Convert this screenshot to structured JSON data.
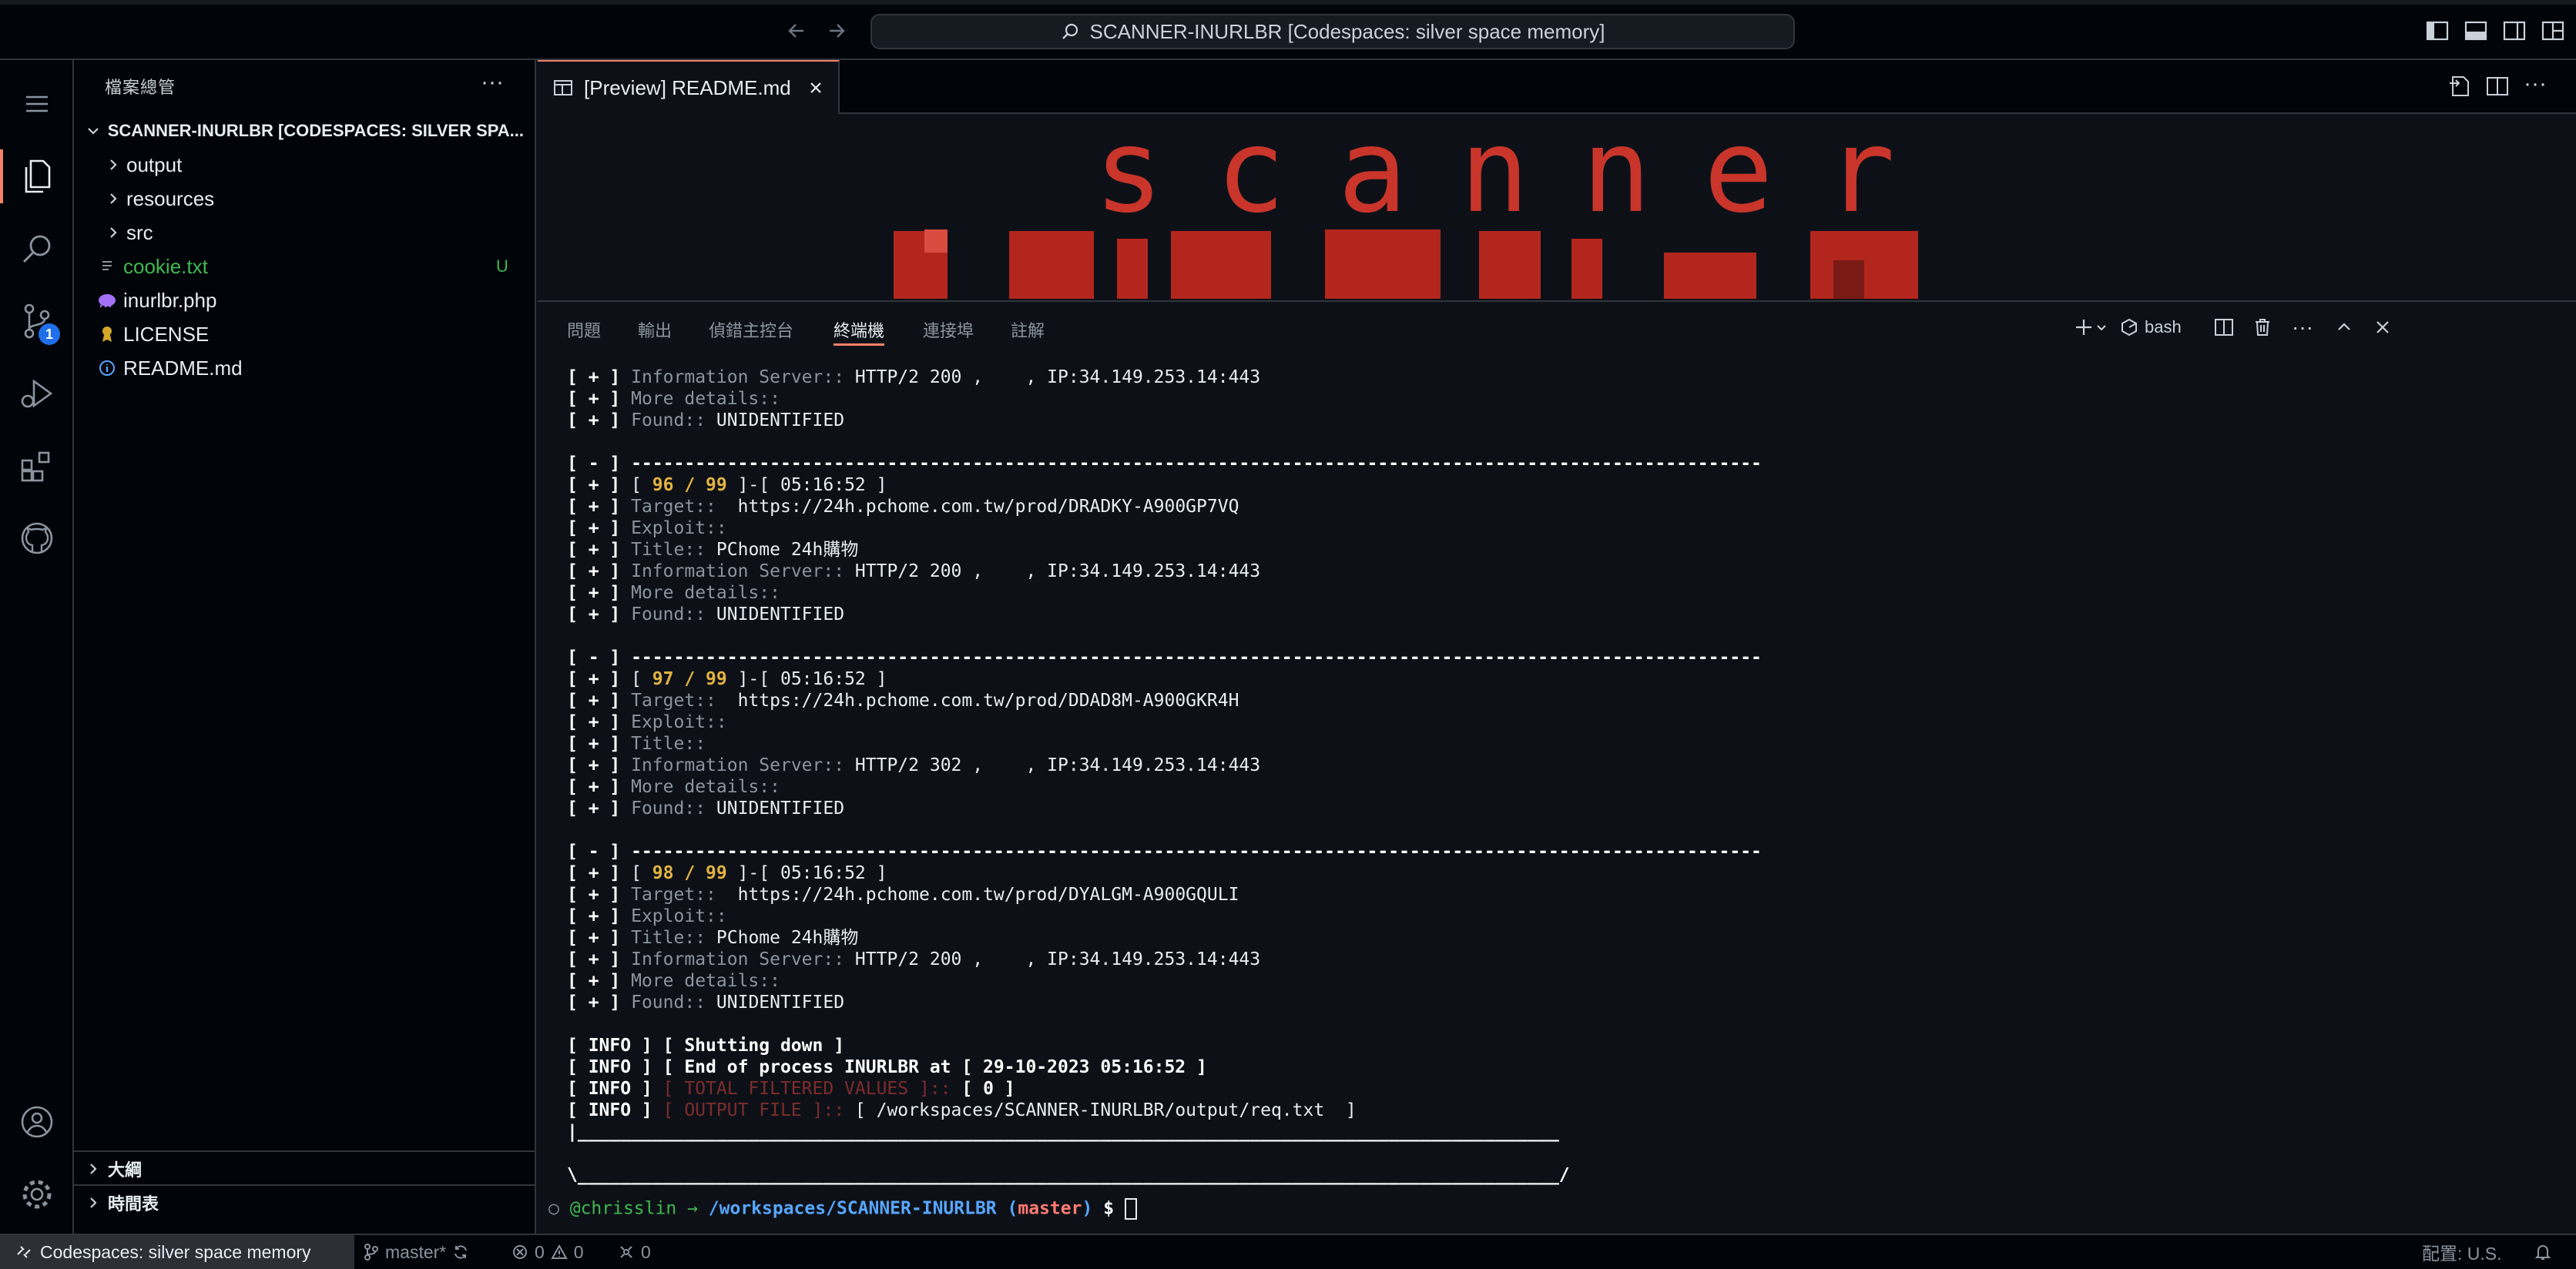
{
  "window": {
    "command_center": "SCANNER-INURLBR [Codespaces: silver space memory]"
  },
  "activity_bar": {
    "scm_badge": "1"
  },
  "sidebar": {
    "title": "檔案總管",
    "root": "SCANNER-INURLBR [CODESPACES: SILVER SPA...",
    "items": [
      {
        "label": "output",
        "type": "folder"
      },
      {
        "label": "resources",
        "type": "folder"
      },
      {
        "label": "src",
        "type": "folder"
      },
      {
        "label": "cookie.txt",
        "type": "file",
        "status": "U",
        "color": "#3fb950"
      },
      {
        "label": "inurlbr.php",
        "type": "file"
      },
      {
        "label": "LICENSE",
        "type": "file"
      },
      {
        "label": "README.md",
        "type": "file"
      }
    ],
    "outline": "大綱",
    "timeline": "時間表"
  },
  "editor": {
    "tab_label": "[Preview] README.md",
    "banner": "scanner"
  },
  "panel": {
    "tabs": [
      "問題",
      "輸出",
      "偵錯主控台",
      "終端機",
      "連接埠",
      "註解"
    ],
    "active_tab": "終端機",
    "shell": "bash",
    "blocks": [
      {
        "num": "96 / 99",
        "time": "05:16:52",
        "target": "https://24h.pchome.com.tw/prod/DRADKY-A900GP7VQ",
        "title": "PChome 24h購物",
        "server": "HTTP/2 200 ,    , IP:34.149.253.14:443"
      },
      {
        "num": "97 / 99",
        "time": "05:16:52",
        "target": "https://24h.pchome.com.tw/prod/DDAD8M-A900GKR4H",
        "title": "",
        "server": "HTTP/2 302 ,    , IP:34.149.253.14:443"
      },
      {
        "num": "98 / 99",
        "time": "05:16:52",
        "target": "https://24h.pchome.com.tw/prod/DYALGM-A900GQULI",
        "title": "PChome 24h購物",
        "server": "HTTP/2 200 ,    , IP:34.149.253.14:443"
      }
    ],
    "first_server": "HTTP/2 200 ,    , IP:34.149.253.14:443",
    "found": "UNIDENTIFIED",
    "info_shutdown": "[ Shutting down ]",
    "info_end": "[ End of process INURLBR at [ 29-10-2023 05:16:52 ]",
    "info_total_label": "[ TOTAL FILTERED VALUES ]::",
    "info_total_value": "[ 0 ]",
    "info_output_label": "[ OUTPUT FILE ]::",
    "info_output_value": "[ /workspaces/SCANNER-INURLBR/output/req.txt  ]",
    "prompt_user": "@chrisslin",
    "prompt_path": "/workspaces/SCANNER-INURLBR",
    "prompt_branch": "master"
  },
  "status_bar": {
    "remote": "Codespaces: silver space memory",
    "branch": "master*",
    "errors": "0",
    "warnings": "0",
    "ports": "0",
    "layout": "配置: U.S."
  }
}
